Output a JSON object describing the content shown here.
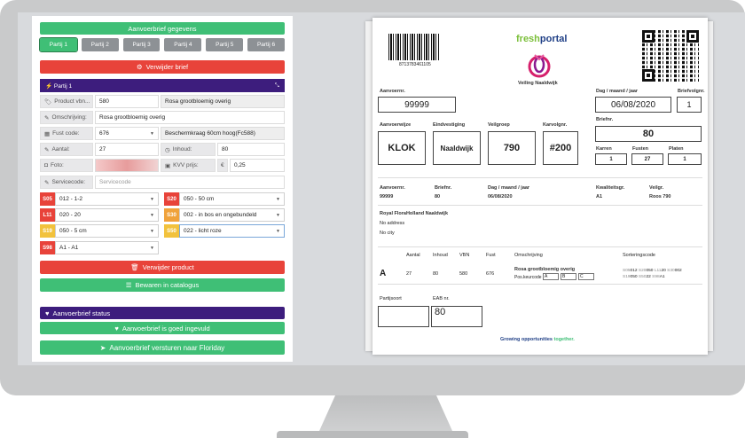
{
  "left": {
    "header": "Aanvoerbrief gegevens",
    "tabs": [
      "Partij 1",
      "Partij 2",
      "Partij 3",
      "Partij 4",
      "Partij 5",
      "Partij 6"
    ],
    "delete_letter": "Verwijder brief",
    "partij_title": "Partij 1",
    "product_label": "Product vbn...",
    "product_code": "580",
    "product_name": "Rosa grootbloemig overig",
    "omschrijving_label": "Omschrijving:",
    "omschrijving_value": "Rosa grootbloemig overig",
    "fust_label": "Fust code:",
    "fust_code": "676",
    "fust_desc": "Beschermkraag 60cm hoog(Fc588)",
    "aantal_label": "Aantal:",
    "aantal_value": "27",
    "inhoud_label": "Inhoud:",
    "inhoud_value": "80",
    "foto_label": "Foto:",
    "kvv_label": "KVV prijs:",
    "kvv_currency": "€",
    "kvv_value": "0,25",
    "servicecode_label": "Servicecode:",
    "servicecode_placeholder": "Servicecode",
    "codes_left": [
      {
        "code": "S05",
        "value": "012 - 1-2"
      },
      {
        "code": "L11",
        "value": "020 - 20"
      },
      {
        "code": "S19",
        "value": "050 - 5 cm"
      },
      {
        "code": "S98",
        "value": "A1 - A1"
      }
    ],
    "codes_right": [
      {
        "code": "S20",
        "value": "050 - 50 cm"
      },
      {
        "code": "S30",
        "value": "002 - in bos en ongebundeld"
      },
      {
        "code": "S50",
        "value": "022 - licht roze"
      }
    ],
    "delete_product": "Verwijder product",
    "save_catalog": "Bewaren in catalogus",
    "status_header": "Aanvoerbrief status",
    "status_ok": "Aanvoerbrief is goed ingevuld",
    "send_button": "Aanvoerbrief versturen naar Floriday"
  },
  "doc": {
    "barcode_number": "8713783461105",
    "logo_text_fresh": "fresh",
    "logo_text_portal": "portal",
    "veiling": "Veiling Naaldwijk",
    "aanvoernr_label": "Aanvoernr.",
    "aanvoernr_value": "99999",
    "date_label": "Dag / maand / jaar",
    "date_value": "06/08/2020",
    "briefvolgnr_label": "Briefvolgnr.",
    "briefvolgnr_value": "1",
    "aanvoerwijze_label": "Aanvoerwijze",
    "aanvoerwijze_value": "KLOK",
    "eindvestiging_label": "Eindvestiging",
    "eindvestiging_value": "Naaldwijk",
    "veilgroep_label": "Veilgroep",
    "veilgroep_value": "790",
    "karvolgnr_label": "Karvolgnr.",
    "karvolgnr_value": "#200",
    "briefnr_label": "Briefnr.",
    "briefnr_value": "80",
    "karren_label": "Karren",
    "karren_value": "1",
    "fusten_label": "Fusten",
    "fusten_value": "27",
    "platen_label": "Platen",
    "platen_value": "1",
    "summary_headers": [
      "Aanvoernr.",
      "Briefnr.",
      "Dag / maand / jaar",
      "Kwaliteitsgr.",
      "Veilgr."
    ],
    "summary_values": [
      "99999",
      "80",
      "06/08/2020",
      "A1",
      "Roos 790"
    ],
    "addressee": "Royal FloraHolland Naaldwijk",
    "no_address": "No address",
    "no_city": "No city",
    "table_headers": [
      "Aantal",
      "Inhoud",
      "VBN",
      "Fust",
      "Omschrijving",
      "Sorteringscode"
    ],
    "row_class": "A",
    "row_values": [
      "27",
      "80",
      "580",
      "676"
    ],
    "row_desc": "Rosa grootbloemig overig",
    "pos_keurcode": "Pos.keurcode",
    "keur_boxes": [
      "A",
      "B",
      "C"
    ],
    "sort_codes_1": [
      "S05",
      "012",
      "S20",
      "050",
      "L11",
      "20",
      "S30",
      "002"
    ],
    "sort_codes_2": [
      "S19",
      "050",
      "S50",
      "22",
      "S98",
      "A1"
    ],
    "partijsoort_label": "Partijsoort",
    "eab_label": "EAB nr.",
    "eab_value": "80",
    "footer_a": "Growing opportunities",
    "footer_b": "together."
  }
}
